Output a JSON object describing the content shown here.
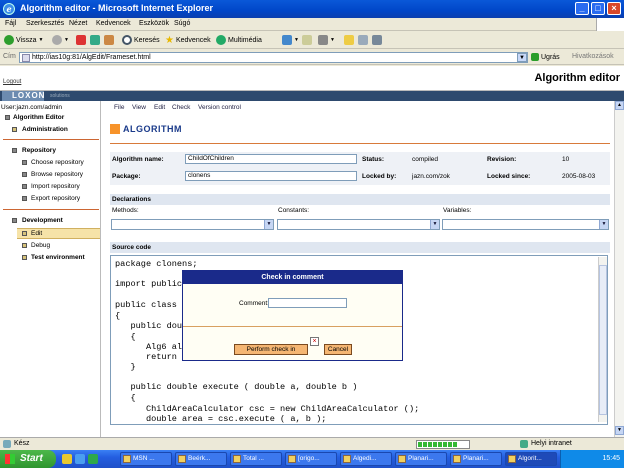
{
  "window": {
    "title": "Algorithm editor - Microsoft Internet Explorer"
  },
  "menubar": [
    "Fájl",
    "Szerkesztés",
    "Nézet",
    "Kedvencek",
    "Eszközök",
    "Súgó"
  ],
  "toolbar": {
    "back": "Vissza",
    "search": "Keresés",
    "favorites": "Kedvencek",
    "multimedia": "Multimédia"
  },
  "address": {
    "label": "Cím",
    "url": "http://ias10g:81/AlgEdit/Frameset.html",
    "go": "Ugrás",
    "links": "Hivatkozások"
  },
  "app": {
    "logout": "Logout",
    "title": "Algorithm editor",
    "brand": "LOXON",
    "brand_sub": "solutions",
    "user": "User:jazn.com/admin"
  },
  "sidebar": {
    "algorithm_editor": "Algorithm Editor",
    "administration": "Administration",
    "repository": "Repository",
    "repo_items": [
      "Choose repository",
      "Browse repository",
      "Import repository",
      "Export repository"
    ],
    "development": "Development",
    "dev_items": [
      "Edit",
      "Debug"
    ],
    "test_environment": "Test environment"
  },
  "main_menu": [
    "File",
    "View",
    "Edit",
    "Check",
    "Version control"
  ],
  "section_title": "ALGORITHM",
  "info": {
    "name_label": "Algorithm name:",
    "name_value": "ChildOfChildren",
    "package_label": "Package:",
    "package_value": "clonens",
    "status_label": "Status:",
    "status_value": "compiled",
    "locked_by_label": "Locked by:",
    "locked_by_value": "jazn.com/zok",
    "revision_label": "Revision:",
    "revision_value": "10",
    "locked_since_label": "Locked since:",
    "locked_since_value": "2005-08-03"
  },
  "declarations": {
    "title": "Declarations",
    "methods": "Methods:",
    "constants": "Constants:",
    "variables": "Variables:"
  },
  "source": {
    "title": "Source code",
    "lines": [
      "package clonens;",
      "import public",
      "public class",
      "{",
      "   public dou",
      "   {",
      "      Alg6 al",
      "      return",
      "   }",
      "   public double execute ( double a, double b )",
      "   {",
      "      ChildAreaCalculator csc = new ChildAreaCalculator ();",
      "      double area = csc.execute ( a, b );"
    ]
  },
  "dialog": {
    "title": "Check in comment",
    "comment_label": "Comment:",
    "comment_value": "",
    "perform": "Perform check in",
    "cancel": "Cancel"
  },
  "statusbar": {
    "left": "Kész",
    "zone": "Helyi intranet",
    "progress_fraction": 0.75
  },
  "taskbar": {
    "start": "Start",
    "tasks": [
      "MSN ...",
      "Beérk...",
      "Total ...",
      "[origo...",
      "Algedi...",
      "Planari...",
      "Planari...",
      "Algorit..."
    ],
    "clock": "15:45"
  }
}
